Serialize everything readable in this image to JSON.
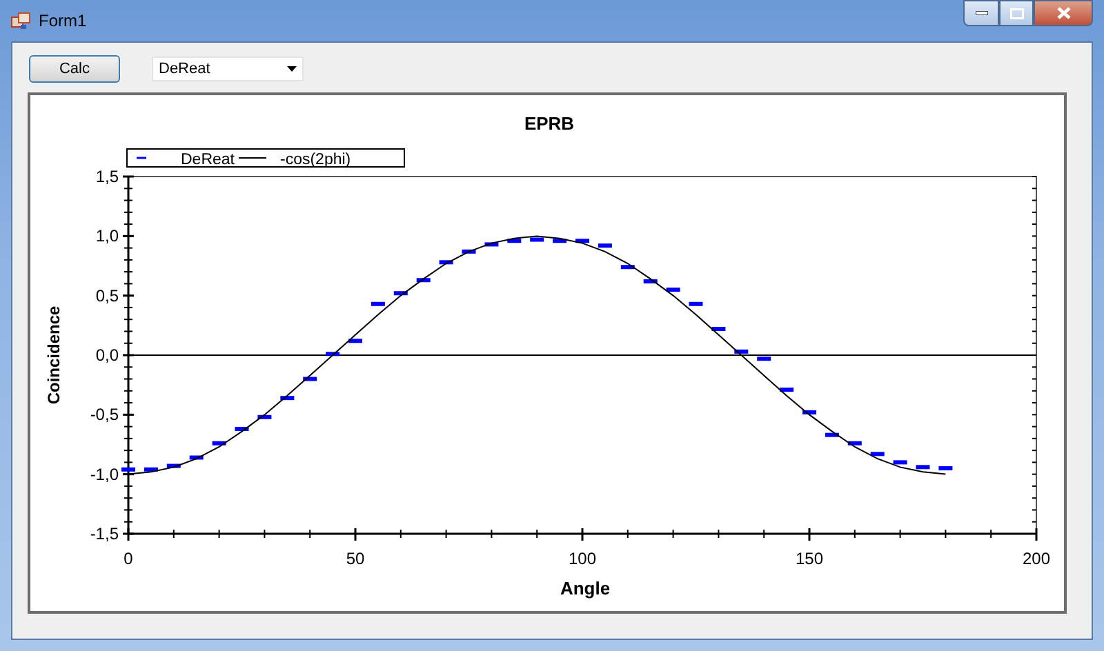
{
  "window": {
    "title": "Form1"
  },
  "toolbar": {
    "button": "Calc",
    "dropdown": {
      "value": "DeReat"
    }
  },
  "chart": {
    "chart_data": {
      "type": "scatter",
      "title": "EPRB",
      "xlabel": "Angle",
      "ylabel": "Coincidence",
      "x": [
        0,
        5,
        10,
        15,
        20,
        25,
        30,
        35,
        40,
        45,
        50,
        55,
        60,
        65,
        70,
        75,
        80,
        85,
        90,
        95,
        100,
        105,
        110,
        115,
        120,
        125,
        130,
        135,
        140,
        145,
        150,
        155,
        160,
        165,
        170,
        175,
        180
      ],
      "series": [
        {
          "name": "DeReat",
          "type": "scatter",
          "color": "#0000ff",
          "values": [
            -0.96,
            -0.96,
            -0.93,
            -0.86,
            -0.74,
            -0.62,
            -0.52,
            -0.36,
            -0.2,
            0.01,
            0.12,
            0.43,
            0.52,
            0.63,
            0.78,
            0.87,
            0.93,
            0.96,
            0.97,
            0.96,
            0.96,
            0.92,
            0.74,
            0.62,
            0.55,
            0.43,
            0.22,
            0.03,
            -0.03,
            -0.29,
            -0.48,
            -0.67,
            -0.74,
            -0.83,
            -0.9,
            -0.94,
            -0.95
          ]
        },
        {
          "name": "-cos(2phi)",
          "type": "line",
          "color": "#000000",
          "values": [
            -1,
            -0.98,
            -0.94,
            -0.87,
            -0.77,
            -0.64,
            -0.5,
            -0.34,
            -0.17,
            0,
            0.17,
            0.34,
            0.5,
            0.64,
            0.77,
            0.87,
            0.94,
            0.98,
            1,
            0.98,
            0.94,
            0.87,
            0.77,
            0.64,
            0.5,
            0.34,
            0.17,
            0,
            -0.17,
            -0.34,
            -0.5,
            -0.64,
            -0.77,
            -0.87,
            -0.94,
            -0.98,
            -1
          ]
        }
      ],
      "legend": "upper left",
      "xlim": [
        0,
        200
      ],
      "ylim": [
        -1.5,
        1.5
      ],
      "xticks": [
        0,
        50,
        100,
        150,
        200
      ],
      "yticks": [
        {
          "value": -1.5,
          "label": "-1,5"
        },
        {
          "value": -1,
          "label": "-1,0"
        },
        {
          "value": -0.5,
          "label": "-0,5"
        },
        {
          "value": 0,
          "label": "0,0"
        },
        {
          "value": 0.5,
          "label": "0,5"
        },
        {
          "value": 1,
          "label": "1,0"
        },
        {
          "value": 1.5,
          "label": "1,5"
        }
      ]
    }
  }
}
